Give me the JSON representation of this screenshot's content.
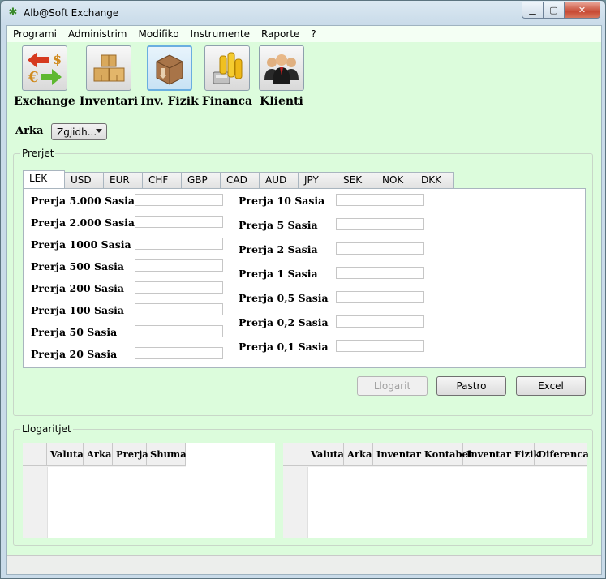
{
  "window": {
    "title": "Alb@Soft Exchange"
  },
  "menu": [
    "Programi",
    "Administrim",
    "Modifiko",
    "Instrumente",
    "Raporte",
    "?"
  ],
  "toolbar": [
    {
      "label": "Exchange",
      "icon": "exchange-icon",
      "active": false
    },
    {
      "label": "Inventari",
      "icon": "inventory-boxes-icon",
      "active": false
    },
    {
      "label": "Inv. Fizik",
      "icon": "box-download-icon",
      "active": true
    },
    {
      "label": "Financa",
      "icon": "coins-calculator-icon",
      "active": false
    },
    {
      "label": "Klienti",
      "icon": "clients-group-icon",
      "active": false
    }
  ],
  "arka": {
    "label": "Arka",
    "selected": "Zgjidh..."
  },
  "prerjet": {
    "title": "Prerjet",
    "tabs": [
      "LEK",
      "USD",
      "EUR",
      "CHF",
      "GBP",
      "CAD",
      "AUD",
      "JPY",
      "SEK",
      "NOK",
      "DKK"
    ],
    "active_tab": "LEK",
    "left_fields": [
      "Prerja 5.000 Sasia",
      "Prerja 2.000 Sasia",
      "Prerja 1000 Sasia",
      "Prerja 500 Sasia",
      "Prerja 200 Sasia",
      "Prerja 100 Sasia",
      "Prerja 50 Sasia",
      "Prerja 20 Sasia"
    ],
    "right_fields": [
      "Prerja 10 Sasia",
      "Prerja 5 Sasia",
      "Prerja 2 Sasia",
      "Prerja 1 Sasia",
      "Prerja 0,5 Sasia",
      "Prerja 0,2 Sasia",
      "Prerja 0,1 Sasia"
    ],
    "buttons": {
      "llogarit": "Llogarit",
      "pastro": "Pastro",
      "excel": "Excel"
    }
  },
  "llogaritjet": {
    "title": "Llogaritjet",
    "left_columns": [
      "Valuta",
      "Arka",
      "Prerja",
      "Shuma"
    ],
    "right_columns": [
      "Valuta",
      "Arka",
      "Inventar Kontabel",
      "Inventar Fizik",
      "Diferenca"
    ]
  }
}
